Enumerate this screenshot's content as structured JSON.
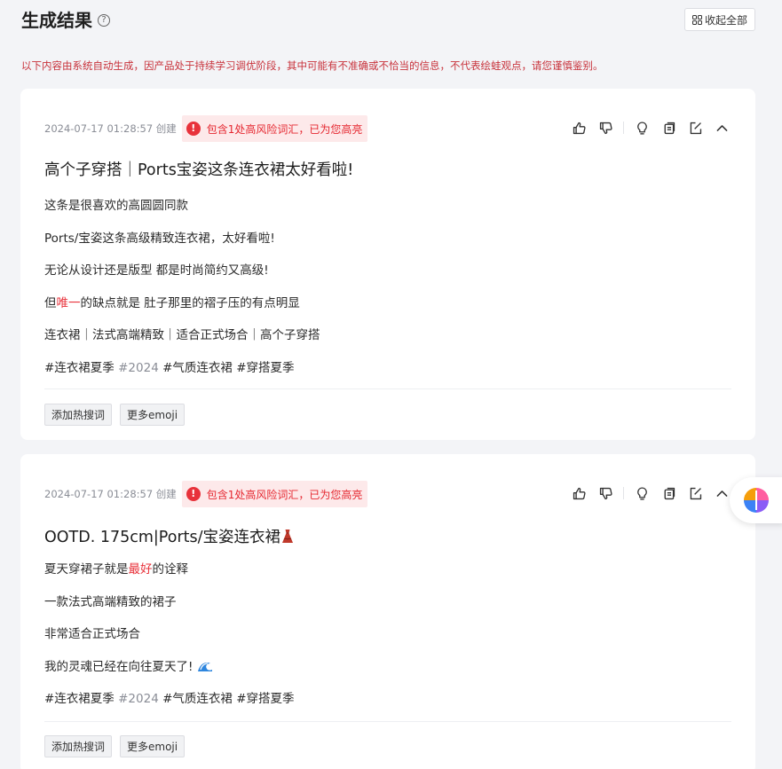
{
  "header": {
    "title": "生成结果",
    "help_icon": "question-circle-icon",
    "collapse_all_label": "收起全部"
  },
  "disclaimer": "以下内容由系统自动生成，因产品处于持续学习调优阶段，其中可能有不准确或不恰当的信息，不代表绘蛙观点，请您谨慎鉴别。",
  "colors": {
    "accent_red": "#e8323b",
    "risk_bg": "#fde9ea",
    "time_gray": "#8a8d96"
  },
  "cards": [
    {
      "time": "2024-07-17 01:28:57 创建",
      "risk": "包含1处高风险词汇，已为您高亮",
      "title": "高个子穿搭｜Ports宝姿这条连衣裙太好看啦!",
      "lines": [
        "这条是很喜欢的高圆圆同款",
        "Ports/宝姿这条高级精致连衣裙，太好看啦!",
        "无论从设计还是版型 都是时尚简约又高级!"
      ],
      "risk_line": {
        "before": "但",
        "highlight": "唯一",
        "after": "的缺点就是 肚子那里的褶子压的有点明显"
      },
      "summary": "连衣裙｜法式高端精致｜适合正式场合｜高个子穿搭",
      "tags": {
        "t1": "#连衣裙夏季",
        "t2": "#2024",
        "t3": "#气质连衣裙",
        "t4": "#穿搭夏季"
      },
      "buttons": {
        "hot": "添加热搜词",
        "emoji": "更多emoji"
      }
    },
    {
      "time": "2024-07-17 01:28:57 创建",
      "risk": "包含1处高风险词汇，已为您高亮",
      "title": "OOTD. 175cm|Ports/宝姿连衣裙",
      "title_emoji": "dress-emoji",
      "risk_line": {
        "before": "夏天穿裙子就是",
        "highlight": "最好",
        "after": "的诠释"
      },
      "lines": [
        "一款法式高端精致的裙子",
        "非常适合正式场合"
      ],
      "wave_line": "我的灵魂已经在向往夏天了!",
      "wave_emoji": "wave-emoji",
      "tags": {
        "t1": "#连衣裙夏季",
        "t2": "#2024",
        "t3": "#气质连衣裙",
        "t4": "#穿搭夏季"
      },
      "buttons": {
        "hot": "添加热搜词",
        "emoji": "更多emoji"
      }
    }
  ],
  "actions": [
    "thumb-up-icon",
    "thumb-down-icon",
    "lightbulb-icon",
    "copy-icon",
    "edit-icon",
    "chevron-up-icon"
  ],
  "assistant_icon": "brain-icon"
}
